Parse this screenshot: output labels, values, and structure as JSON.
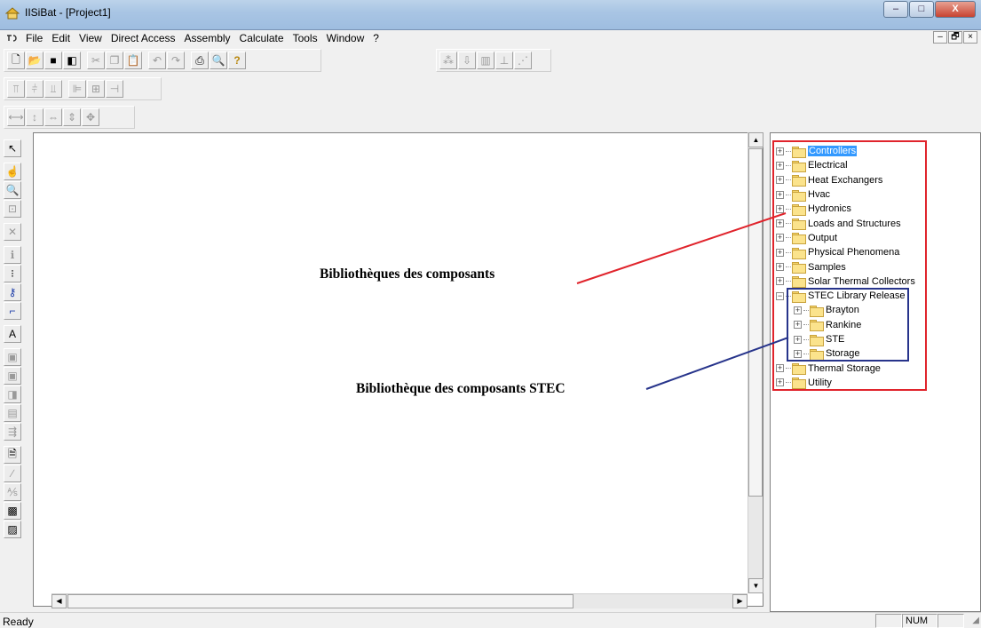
{
  "window": {
    "title": "IISiBat - [Project1]",
    "controls": [
      "–",
      "□",
      "X"
    ]
  },
  "menu": {
    "items": [
      "File",
      "Edit",
      "View",
      "Direct Access",
      "Assembly",
      "Calculate",
      "Tools",
      "Window",
      "?"
    ],
    "mdi_controls": [
      "–",
      "🗗",
      "×"
    ]
  },
  "toolbar_main": {
    "buttons": [
      "new-icon",
      "open-icon",
      "save-icon",
      "save-all-icon",
      "cut-icon",
      "copy-icon",
      "paste-icon",
      "undo-icon",
      "redo-icon",
      "print-icon",
      "print-preview-icon",
      "help-icon"
    ]
  },
  "toolbar_right": {
    "buttons": [
      "network-icon",
      "download-icon",
      "table-icon",
      "component-icon",
      "pdr-icon"
    ]
  },
  "toolbar_align": {
    "buttons": [
      "align-top-icon",
      "align-middle-icon",
      "align-bottom-icon",
      "align-left-icon",
      "align-center-icon",
      "align-right-icon"
    ]
  },
  "toolbar_space": {
    "buttons": [
      "space-horizontal-icon",
      "space-vertical-icon",
      "same-width-icon",
      "same-height-icon",
      "same-size-icon"
    ]
  },
  "left_toolbar": {
    "buttons": [
      "pointer-icon",
      "hand-icon",
      "zoom-icon",
      "zoom-box-icon",
      "delete-icon",
      "info-icon",
      "link-icon",
      "key-icon",
      "connector-icon",
      "text-icon",
      "component-a-icon",
      "component-b-icon",
      "component-c-icon",
      "component-d-icon",
      "component-e-icon",
      "document-icon",
      "pen-icon",
      "formula-icon",
      "dck-icon",
      "stp-icon"
    ]
  },
  "tree": {
    "items": [
      {
        "label": "Controllers",
        "selected": true,
        "expanded": false
      },
      {
        "label": "Electrical",
        "expanded": false
      },
      {
        "label": "Heat Exchangers",
        "expanded": false
      },
      {
        "label": "Hvac",
        "expanded": false
      },
      {
        "label": "Hydronics",
        "expanded": false
      },
      {
        "label": "Loads and Structures",
        "expanded": false
      },
      {
        "label": "Output",
        "expanded": false
      },
      {
        "label": "Physical Phenomena",
        "expanded": false
      },
      {
        "label": "Samples",
        "expanded": false
      },
      {
        "label": "Solar Thermal Collectors",
        "expanded": false
      },
      {
        "label": "STEC Library Release",
        "expanded": true,
        "children": [
          {
            "label": "Brayton"
          },
          {
            "label": "Rankine"
          },
          {
            "label": "STE"
          },
          {
            "label": "Storage"
          }
        ]
      },
      {
        "label": "Thermal Storage",
        "expanded": false
      },
      {
        "label": "Utility",
        "expanded": false
      }
    ]
  },
  "annotations": {
    "libraries": "Bibliothèques des composants",
    "stec_library": "Bibliothèque des composants STEC",
    "colors": {
      "libraries": "#e0242c",
      "stec": "#27348b"
    }
  },
  "status": {
    "text": "Ready",
    "num": "NUM"
  }
}
